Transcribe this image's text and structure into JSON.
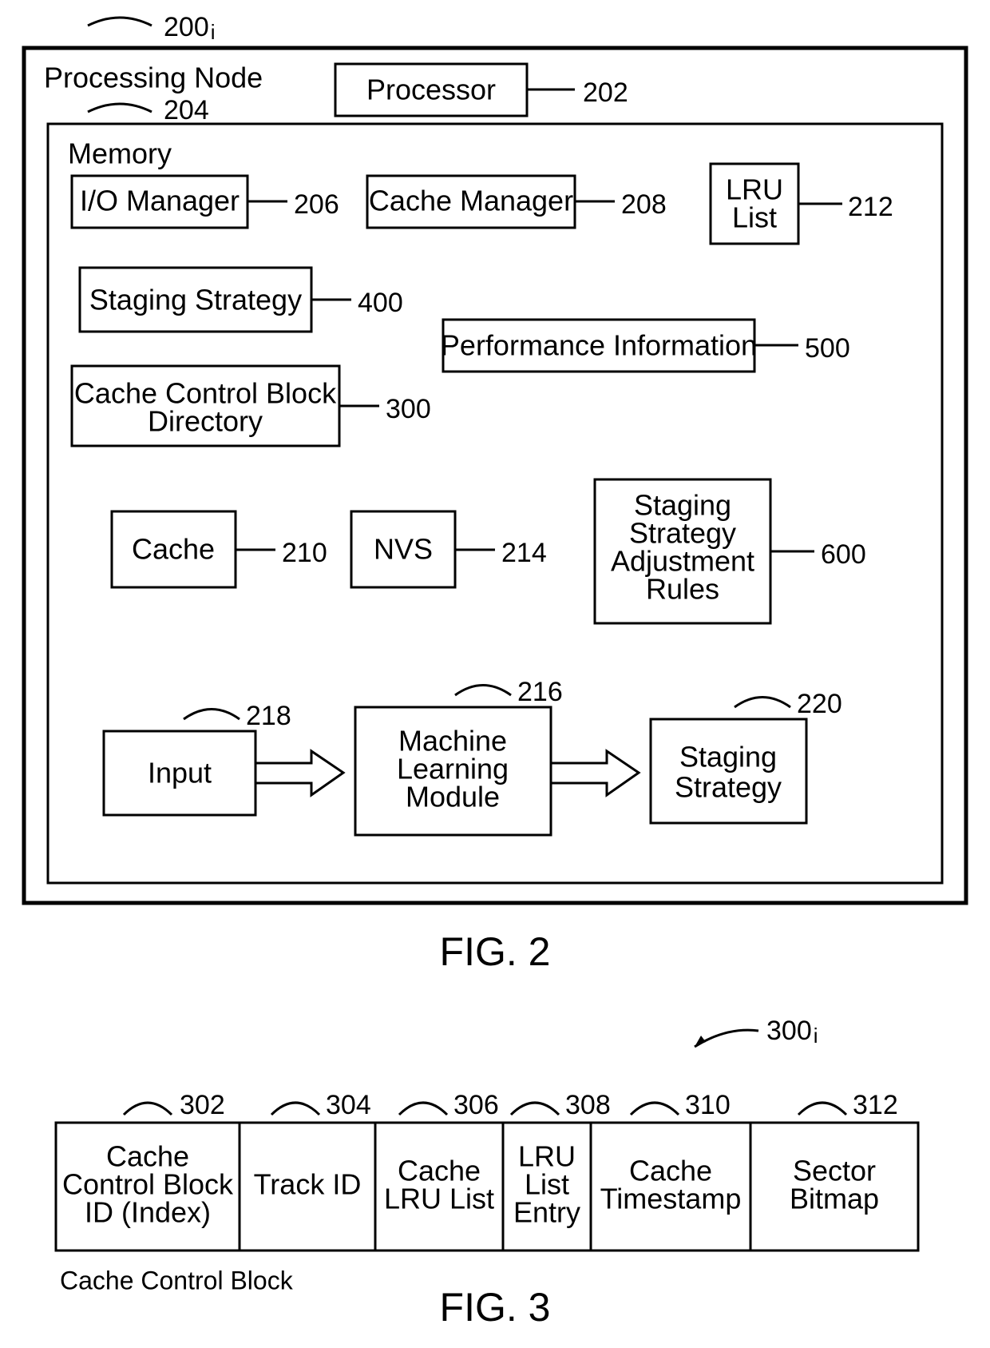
{
  "fig2": {
    "title": "FIG. 2",
    "outer_ref": "200",
    "outer_ref_sub": "i",
    "outer_label": "Processing Node",
    "processor": {
      "label": "Processor",
      "ref": "202"
    },
    "memory_ref": "204",
    "memory_label": "Memory",
    "io_manager": {
      "label": "I/O Manager",
      "ref": "206"
    },
    "cache_manager": {
      "label": "Cache Manager",
      "ref": "208"
    },
    "lru_list": {
      "label1": "LRU",
      "label2": "List",
      "ref": "212"
    },
    "staging_strategy": {
      "label": "Staging Strategy",
      "ref": "400"
    },
    "performance_info": {
      "label": "Performance Information",
      "ref": "500"
    },
    "ccb_directory": {
      "label1": "Cache Control Block",
      "label2": "Directory",
      "ref": "300"
    },
    "cache": {
      "label": "Cache",
      "ref": "210"
    },
    "nvs": {
      "label": "NVS",
      "ref": "214"
    },
    "rules": {
      "label1": "Staging",
      "label2": "Strategy",
      "label3": "Adjustment",
      "label4": "Rules",
      "ref": "600"
    },
    "input": {
      "label": "Input",
      "ref": "218"
    },
    "mlm": {
      "label1": "Machine",
      "label2": "Learning",
      "label3": "Module",
      "ref": "216"
    },
    "out_strategy": {
      "label1": "Staging",
      "label2": "Strategy",
      "ref": "220"
    }
  },
  "fig3": {
    "title": "FIG. 3",
    "table_ref": "300",
    "table_ref_sub": "i",
    "caption": "Cache Control Block",
    "cols": [
      {
        "ref": "302",
        "l1": "Cache",
        "l2": "Control Block",
        "l3": "ID (Index)"
      },
      {
        "ref": "304",
        "l1": "Track ID"
      },
      {
        "ref": "306",
        "l1": "Cache",
        "l2": "LRU List"
      },
      {
        "ref": "308",
        "l1": "LRU",
        "l2": "List",
        "l3": "Entry"
      },
      {
        "ref": "310",
        "l1": "Cache",
        "l2": "Timestamp"
      },
      {
        "ref": "312",
        "l1": "Sector",
        "l2": "Bitmap"
      }
    ]
  }
}
